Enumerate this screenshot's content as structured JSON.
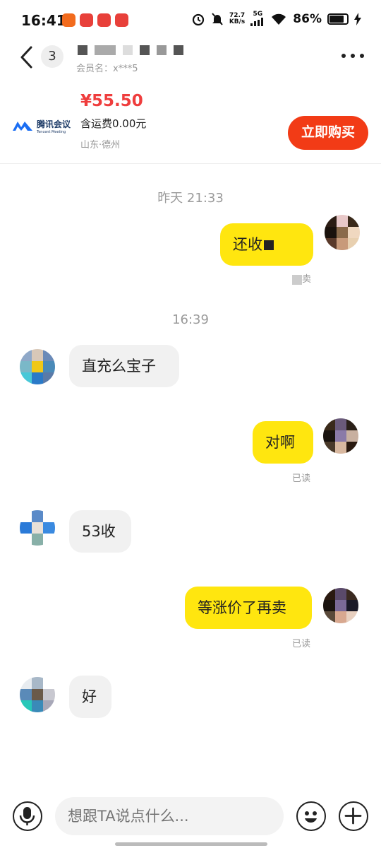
{
  "status_bar": {
    "time": "16:41",
    "net_speed_value": "72.7",
    "net_speed_unit": "KB/s",
    "network": "5G",
    "battery": "86%",
    "battery_level": 0.86
  },
  "header": {
    "unread_count": "3",
    "member_label": "会员名：x***5",
    "more_icon": "more-horizontal-icon",
    "back_icon": "chevron-left-icon"
  },
  "product": {
    "logo_cn": "腾讯会议",
    "logo_en": "Tencent Meeting",
    "price": "¥55.50",
    "shipping": "含运费0.00元",
    "location": "山东·德州",
    "buy_label": "立即购买"
  },
  "chat": {
    "timestamps": [
      "昨天 21:33",
      "16:39"
    ],
    "messages": [
      {
        "side": "me",
        "text": "还收",
        "status": "卖"
      },
      {
        "side": "them",
        "text": "直充么宝子"
      },
      {
        "side": "me",
        "text": "对啊",
        "status": "已读"
      },
      {
        "side": "them",
        "text": "53收"
      },
      {
        "side": "me",
        "text": "等涨价了再卖",
        "status": "已读"
      },
      {
        "side": "them",
        "text": "好"
      }
    ]
  },
  "input_bar": {
    "placeholder": "想跟TA说点什么...",
    "voice_icon": "microphone-icon",
    "emoji_icon": "smiley-icon",
    "plus_icon": "plus-icon"
  },
  "colors": {
    "accent_red": "#ef3d3d",
    "buy_button": "#f23b16",
    "my_bubble": "#ffe60f",
    "their_bubble": "#f1f1f1"
  }
}
